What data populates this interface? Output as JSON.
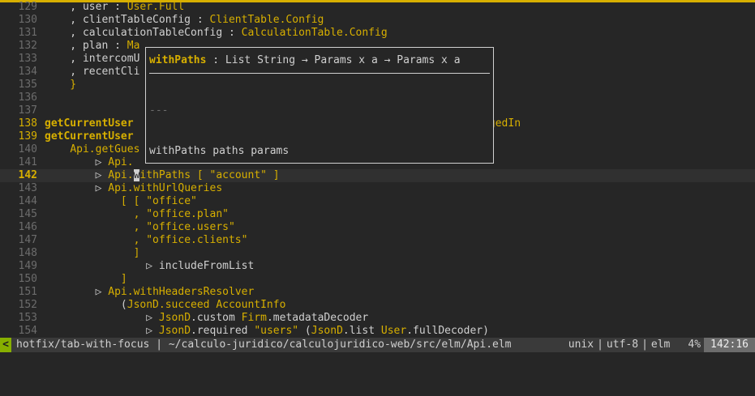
{
  "editor": {
    "lines": [
      {
        "num": "129",
        "code": [
          {
            "t": "    , user : "
          },
          {
            "t": "User.Full",
            "c": "k"
          }
        ]
      },
      {
        "num": "130",
        "code": [
          {
            "t": "    , clientTableConfig : "
          },
          {
            "t": "ClientTable.Config",
            "c": "k"
          }
        ]
      },
      {
        "num": "131",
        "code": [
          {
            "t": "    , calculationTableConfig : "
          },
          {
            "t": "CalculationTable.Config",
            "c": "k"
          }
        ]
      },
      {
        "num": "132",
        "code": [
          {
            "t": "    , plan : "
          },
          {
            "t": "Ma",
            "c": "k"
          }
        ]
      },
      {
        "num": "133",
        "code": [
          {
            "t": "    , intercomU"
          }
        ]
      },
      {
        "num": "134",
        "code": [
          {
            "t": "    , recentCli"
          }
        ]
      },
      {
        "num": "135",
        "code": [
          {
            "t": "    }",
            "c": "k"
          }
        ]
      },
      {
        "num": "136",
        "code": []
      },
      {
        "num": "137",
        "code": []
      },
      {
        "num": "138",
        "mark": true,
        "code": [
          {
            "t": "getCurrentUser",
            "c": "k bold"
          },
          {
            "t": "                                                  "
          },
          {
            "t": "on.LoggedIn",
            "c": "k"
          }
        ]
      },
      {
        "num": "139",
        "mark": true,
        "code": [
          {
            "t": "getCurrentUser",
            "c": "k bold"
          }
        ]
      },
      {
        "num": "140",
        "code": [
          {
            "t": "    "
          },
          {
            "t": "Api.getGues",
            "c": "k"
          }
        ]
      },
      {
        "num": "141",
        "code": [
          {
            "t": "        ▷ "
          },
          {
            "t": "Api.",
            "c": "k"
          }
        ]
      },
      {
        "num": "142",
        "current": true,
        "code": [
          {
            "t": "        ▷ "
          },
          {
            "t": "Api.",
            "c": "k"
          },
          {
            "t": "w",
            "c": "cursor"
          },
          {
            "t": "ithPaths",
            "c": "k"
          },
          {
            "t": " [ ",
            "c": "k"
          },
          {
            "t": "\"account\"",
            "c": "s"
          },
          {
            "t": " ]",
            "c": "k"
          }
        ]
      },
      {
        "num": "143",
        "code": [
          {
            "t": "        ▷ "
          },
          {
            "t": "Api.withUrlQueries",
            "c": "k"
          }
        ]
      },
      {
        "num": "144",
        "code": [
          {
            "t": "            [ [ ",
            "c": "k"
          },
          {
            "t": "\"office\"",
            "c": "s"
          }
        ]
      },
      {
        "num": "145",
        "code": [
          {
            "t": "              , ",
            "c": "k"
          },
          {
            "t": "\"office.plan\"",
            "c": "s"
          }
        ]
      },
      {
        "num": "146",
        "code": [
          {
            "t": "              , ",
            "c": "k"
          },
          {
            "t": "\"office.users\"",
            "c": "s"
          }
        ]
      },
      {
        "num": "147",
        "code": [
          {
            "t": "              , ",
            "c": "k"
          },
          {
            "t": "\"office.clients\"",
            "c": "s"
          }
        ]
      },
      {
        "num": "148",
        "code": [
          {
            "t": "              ]",
            "c": "k"
          }
        ]
      },
      {
        "num": "149",
        "code": [
          {
            "t": "                ▷ includeFromList"
          }
        ]
      },
      {
        "num": "150",
        "code": [
          {
            "t": "            ]",
            "c": "k"
          }
        ]
      },
      {
        "num": "151",
        "code": [
          {
            "t": "        ▷ "
          },
          {
            "t": "Api.withHeadersResolver",
            "c": "k"
          }
        ]
      },
      {
        "num": "152",
        "code": [
          {
            "t": "            ("
          },
          {
            "t": "JsonD.succeed AccountInfo",
            "c": "k"
          }
        ]
      },
      {
        "num": "153",
        "code": [
          {
            "t": "                ▷ "
          },
          {
            "t": "JsonD",
            "c": "k"
          },
          {
            "t": ".custom "
          },
          {
            "t": "Firm",
            "c": "k"
          },
          {
            "t": ".metadataDecoder"
          }
        ]
      },
      {
        "num": "154",
        "code": [
          {
            "t": "                ▷ "
          },
          {
            "t": "JsonD",
            "c": "k"
          },
          {
            "t": ".required "
          },
          {
            "t": "\"users\"",
            "c": "s"
          },
          {
            "t": " ("
          },
          {
            "t": "JsonD",
            "c": "k"
          },
          {
            "t": ".list "
          },
          {
            "t": "User",
            "c": "k"
          },
          {
            "t": ".fullDecoder)"
          }
        ]
      }
    ]
  },
  "popup": {
    "fn_name": "withPaths",
    "signature_rest": " : List String → Params x a → Params x a",
    "separator": "---",
    "example": "withPaths paths params"
  },
  "statusbar": {
    "mode": "<",
    "branch": "hotfix/tab-with-focus",
    "sep": "|",
    "path": "~/calculo-juridico/calculojuridico-web/src/elm/Api.elm",
    "fileformat": "unix",
    "encoding": "utf-8",
    "filetype": "elm",
    "percent": "4%",
    "position": "142:16"
  },
  "colors": {
    "background": "#262626",
    "accent": "#d7af00",
    "mode": "#87af00"
  }
}
